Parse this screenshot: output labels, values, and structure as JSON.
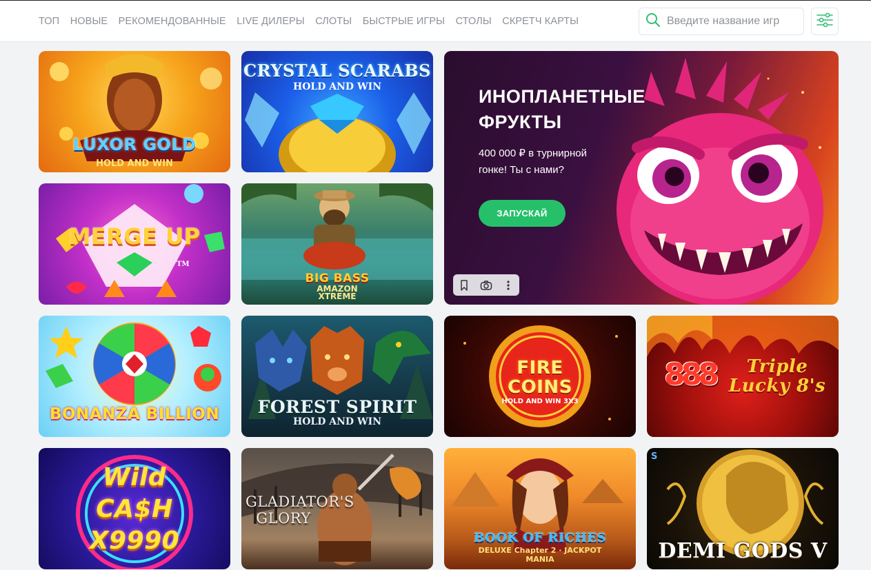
{
  "nav": {
    "items": [
      "ТОП",
      "НОВЫЕ",
      "РЕКОМЕНДОВАННЫЕ",
      "LIVE ДИЛЕРЫ",
      "СЛОТЫ",
      "БЫСТРЫЕ ИГРЫ",
      "СТОЛЫ",
      "СКРЕТЧ КАРТЫ"
    ]
  },
  "search": {
    "placeholder": "Введите название игр",
    "icon": "search-icon"
  },
  "filter": {
    "icon": "sliders-icon"
  },
  "banner": {
    "title": "ИНОПЛАНЕТНЫЕ ФРУКТЫ",
    "description": "400 000 ₽ в турнирной гонке! Ты с нами?",
    "button": "ЗАПУСКАЙ",
    "tools": [
      "bookmark-icon",
      "camera-icon",
      "more-vertical-icon"
    ]
  },
  "games": [
    {
      "title": "LUXOR GOLD",
      "subtitle": "HOLD AND WIN"
    },
    {
      "title": "CRYSTAL SCARABS",
      "subtitle": "HOLD AND WIN"
    },
    {
      "title": "MERGE UP",
      "subtitle": "TM"
    },
    {
      "title": "BIG BASS",
      "subtitle": "AMAZON XTREME"
    },
    {
      "title": "BONANZA BILLION",
      "subtitle": ""
    },
    {
      "title": "FOREST SPIRIT",
      "subtitle": "HOLD AND WIN"
    },
    {
      "title": "FIRE COINS",
      "subtitle": "HOLD AND WIN 3X3"
    },
    {
      "title": "Triple Lucky 8's",
      "subtitle": "888"
    },
    {
      "title": "Wild CA$H X9990",
      "subtitle": ""
    },
    {
      "title": "GLADIATOR'S GLORY",
      "subtitle": ""
    },
    {
      "title": "BOOK OF RICHES",
      "subtitle": "DELUXE Chapter 2 · JACKPOT MANIA"
    },
    {
      "title": "DEMI GODS V",
      "subtitle": ""
    }
  ],
  "colors": {
    "accent": "#26c06b",
    "nav_text": "#8c9198",
    "page_bg": "#f2f3f5"
  }
}
